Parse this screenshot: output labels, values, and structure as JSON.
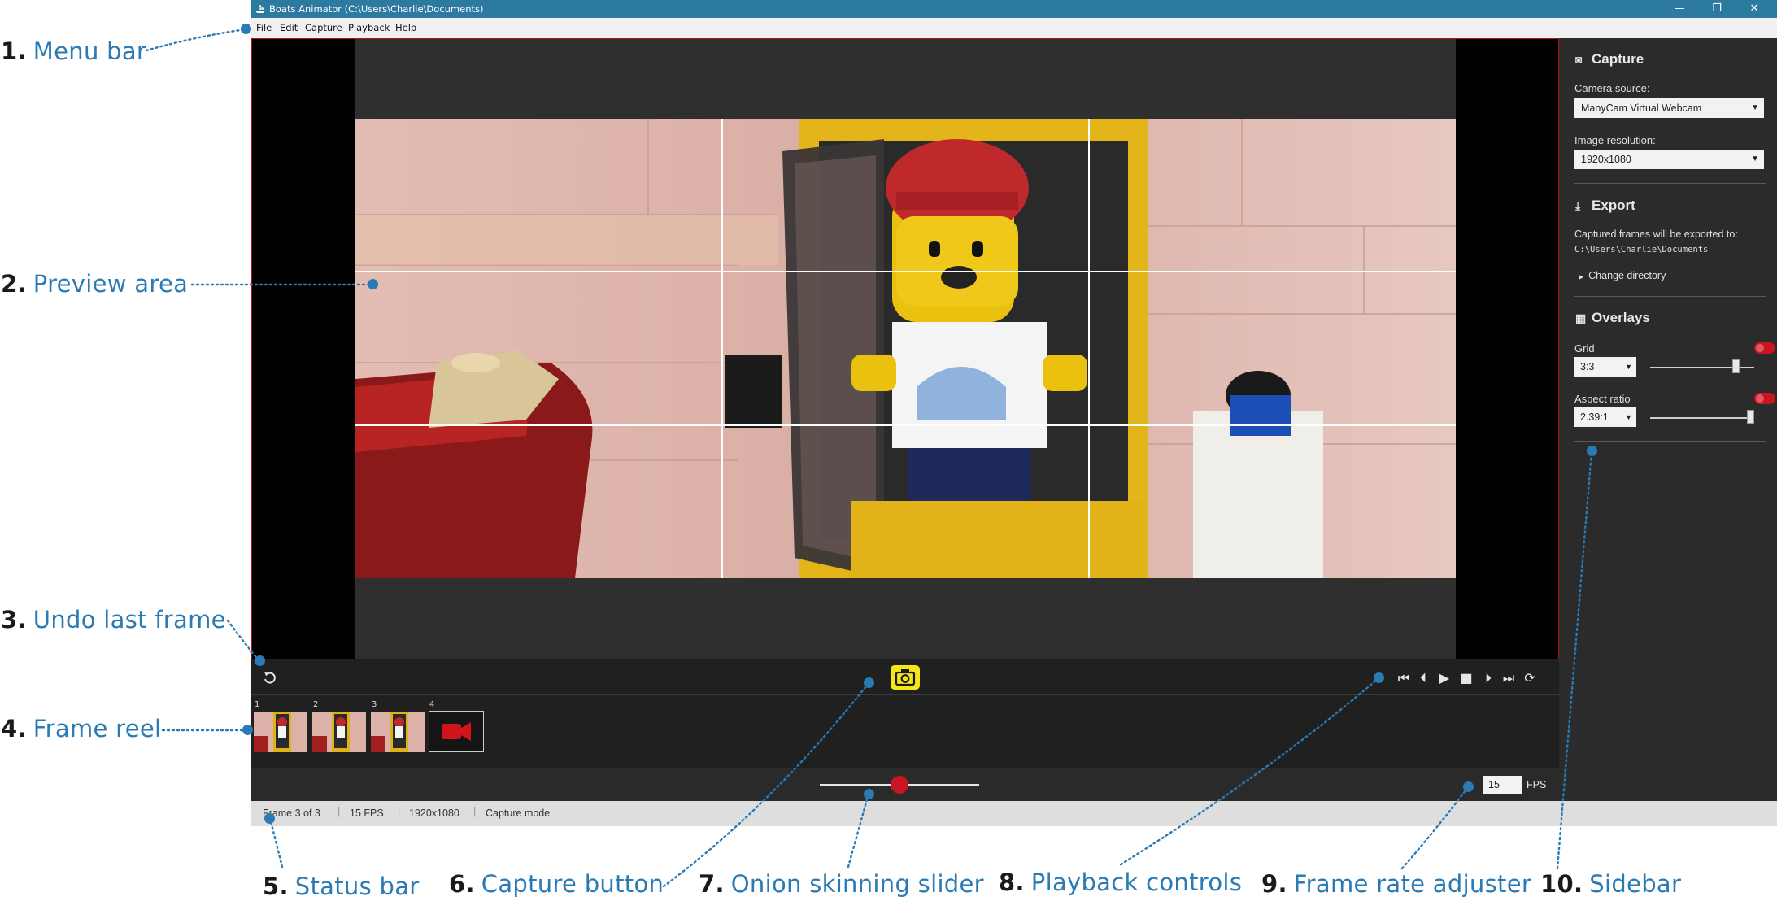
{
  "window": {
    "title": "Boats Animator (C:\\Users\\Charlie\\Documents)",
    "minimize_glyph": "—",
    "restore_glyph": "❐",
    "close_glyph": "✕",
    "app_icon": "boat-icon"
  },
  "menu": [
    "File",
    "Edit",
    "Capture",
    "Playback",
    "Help"
  ],
  "reel": {
    "frames": [
      {
        "number": "1"
      },
      {
        "number": "2"
      },
      {
        "number": "3"
      },
      {
        "number": "4"
      }
    ],
    "live_icon": "video-camera-icon"
  },
  "toolbar": {
    "undo_icon": "undo-icon",
    "capture_icon": "camera-icon",
    "playback_icons": [
      "first-frame-icon",
      "previous-frame-icon",
      "play-icon",
      "stop-icon",
      "next-frame-icon",
      "last-frame-icon",
      "loop-icon"
    ]
  },
  "frame_rate": {
    "value": "15",
    "unit": "FPS"
  },
  "onion_skin": {
    "level": 0.5
  },
  "status": {
    "frame": "Frame 3 of 3",
    "fps": "15 FPS",
    "resolution": "1920x1080",
    "mode": "Capture mode"
  },
  "sidebar": {
    "capture": {
      "title": "Capture",
      "camera_label": "Camera source:",
      "camera_value": "ManyCam Virtual Webcam",
      "resolution_label": "Image resolution:",
      "resolution_value": "1920x1080"
    },
    "export": {
      "title": "Export",
      "desc": "Captured frames will be exported to:",
      "path": "C:\\Users\\Charlie\\Documents",
      "change_dir": "Change directory"
    },
    "overlays": {
      "title": "Overlays",
      "grid_label": "Grid",
      "grid_value": "3:3",
      "grid_slider": 0.82,
      "aspect_label": "Aspect ratio",
      "aspect_value": "2.39:1",
      "aspect_slider": 0.96
    }
  },
  "callouts": [
    {
      "number": "1.",
      "label": "Menu bar"
    },
    {
      "number": "2.",
      "label": "Preview area"
    },
    {
      "number": "3.",
      "label": "Undo last frame"
    },
    {
      "number": "4.",
      "label": "Frame reel"
    },
    {
      "number": "5.",
      "label": "Status bar"
    },
    {
      "number": "6.",
      "label": "Capture button"
    },
    {
      "number": "7.",
      "label": "Onion skinning slider"
    },
    {
      "number": "8.",
      "label": "Playback controls"
    },
    {
      "number": "9.",
      "label": "Frame rate adjuster"
    },
    {
      "number": "10.",
      "label": "Sidebar"
    }
  ],
  "colors": {
    "title_bar": "#2d7aa0",
    "callout_text": "#2a7ab3",
    "accent_red": "#c8151f",
    "capture_yellow": "#f5e61a"
  }
}
